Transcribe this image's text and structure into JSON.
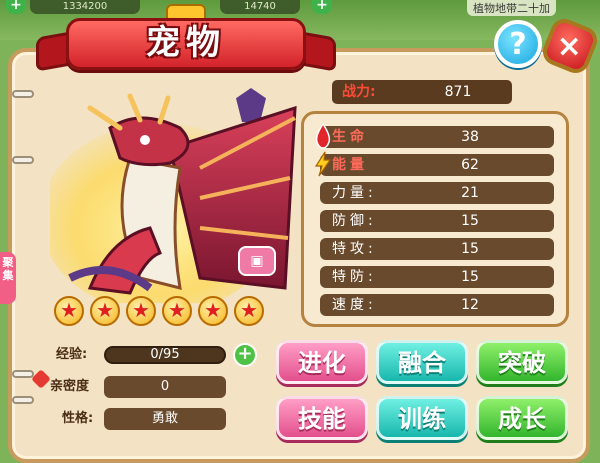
{
  "topbar": {
    "coins": "1334200",
    "gems": "14740",
    "right_text": "植物地带二十加"
  },
  "title": "宠物",
  "buttons": {
    "help": "?",
    "close": "×",
    "side_tab": "聚集"
  },
  "pet": {
    "stars": 6,
    "star_glyph": "★",
    "lock_icon": "lock-icon"
  },
  "power": {
    "label": "战力:",
    "value": "871"
  },
  "stats": [
    {
      "label": "生命",
      "value": "38"
    },
    {
      "label": "能量",
      "value": "62"
    },
    {
      "label": "力量:",
      "value": "21"
    },
    {
      "label": "防御:",
      "value": "15"
    },
    {
      "label": "特攻:",
      "value": "15"
    },
    {
      "label": "特防:",
      "value": "15"
    },
    {
      "label": "速度:",
      "value": "12"
    }
  ],
  "info": {
    "exp_label": "经验:",
    "exp_value": "0/95",
    "intimacy_label": "亲密度",
    "intimacy_value": "0",
    "personality_label": "性格:",
    "personality_value": "勇敢"
  },
  "actions": {
    "evolve": "进化",
    "fuse": "融合",
    "breakthrough": "突破",
    "skill": "技能",
    "train": "训练",
    "grow": "成长"
  },
  "colors": {
    "accent_red": "#d3232b",
    "panel_bg": "#f3e3c4",
    "stat_row_bg": "#6a4a2c"
  }
}
